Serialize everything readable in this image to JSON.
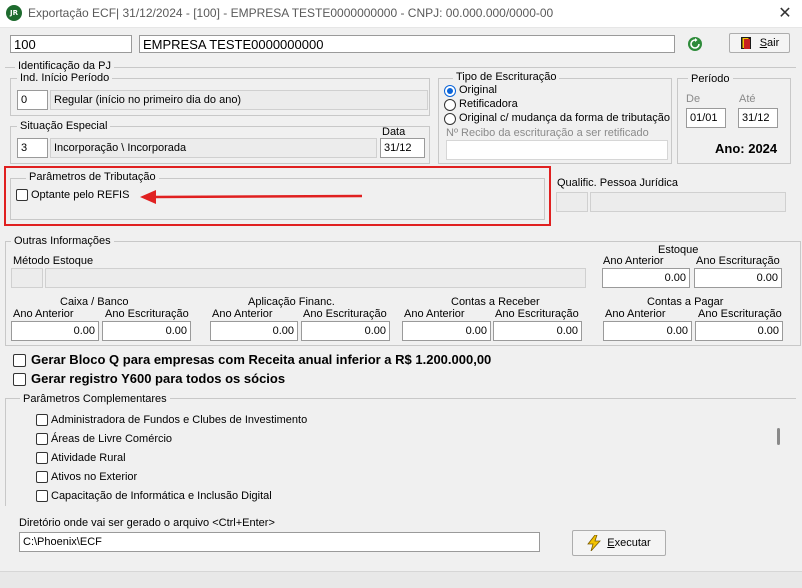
{
  "window": {
    "title": "Exportação ECF| 31/12/2024 - [100] - EMPRESA TESTE0000000000 - CNPJ: 00.000.000/0000-00",
    "icon_text": "JR"
  },
  "header": {
    "company_code": "100",
    "company_name": "EMPRESA TESTE0000000000",
    "exit_label_prefix": "S",
    "exit_label_rest": "air"
  },
  "identificacao": {
    "title": "Identificação da PJ",
    "inicio_periodo": {
      "title": "Ind. Início Período",
      "code": "0",
      "desc": "Regular (início no primeiro dia do ano)"
    },
    "situacao_especial": {
      "title": "Situação Especial",
      "data_label": "Data",
      "code": "3",
      "desc": "Incorporação \\ Incorporada",
      "data": "31/12"
    }
  },
  "tipo_escrituracao": {
    "title": "Tipo de Escrituração",
    "options": [
      "Original",
      "Retificadora",
      "Original c/ mudança da forma de tributação"
    ],
    "selected_index": 0,
    "recibo_label": "Nº Recibo da escrituração a ser retificado",
    "recibo_value": ""
  },
  "periodo": {
    "title": "Período",
    "de_label": "De",
    "ate_label": "Até",
    "de": "01/01",
    "ate": "31/12",
    "ano_label": "Ano: 2024"
  },
  "parametros_tributacao": {
    "title": "Parâmetros de Tributação",
    "refis_label": "Optante pelo REFIS",
    "refis_checked": false
  },
  "qualificacao": {
    "label": "Qualific. Pessoa Jurídica",
    "code": "",
    "desc": ""
  },
  "outras": {
    "title": "Outras Informações",
    "metodo_label": "Método Estoque",
    "estoque": {
      "title": "Estoque",
      "ano_anterior_label": "Ano Anterior",
      "ano_escrituracao_label": "Ano Escrituração",
      "ano_anterior": "0.00",
      "ano_escrituracao": "0.00"
    },
    "caixa": {
      "title": "Caixa / Banco",
      "ano_anterior_label": "Ano  Anterior",
      "ano_escrituracao_label": "Ano Escrituração",
      "ano_anterior": "0.00",
      "ano_escrituracao": "0.00"
    },
    "aplicacao": {
      "title": "Aplicação Financ.",
      "ano_anterior_label": "Ano  Anterior",
      "ano_escrituracao_label": "Ano Escrituração",
      "ano_anterior": "0.00",
      "ano_escrituracao": "0.00"
    },
    "receber": {
      "title": "Contas a Receber",
      "ano_anterior_label": "Ano Anterior",
      "ano_escrituracao_label": "Ano Escrituração",
      "ano_anterior": "0.00",
      "ano_escrituracao": "0.00"
    },
    "pagar": {
      "title": "Contas a Pagar",
      "ano_anterior_label": "Ano Anterior",
      "ano_escrituracao_label": "Ano Escrituração",
      "ano_anterior": "0.00",
      "ano_escrituracao": "0.00"
    }
  },
  "bloco_q_label": "Gerar Bloco Q para empresas com Receita anual inferior a R$ 1.200.000,00",
  "registro_y600_label": "Gerar registro Y600 para todos os sócios",
  "complementares": {
    "title": "Parâmetros Complementares",
    "items": [
      "Administradora de Fundos e Clubes de Investimento",
      "Áreas de Livre Comércio",
      "Atividade Rural",
      "Ativos no Exterior",
      "Capacitação de Informática e Inclusão Digital"
    ]
  },
  "diretorio": {
    "label": "Diretório onde vai ser gerado o arquivo <Ctrl+Enter>",
    "value": "C:\\Phoenix\\ECF"
  },
  "executar": {
    "label_prefix": "E",
    "label_rest": "xecutar"
  },
  "colors": {
    "highlight_red": "#e02020",
    "radio_blue": "#0a64d8"
  }
}
